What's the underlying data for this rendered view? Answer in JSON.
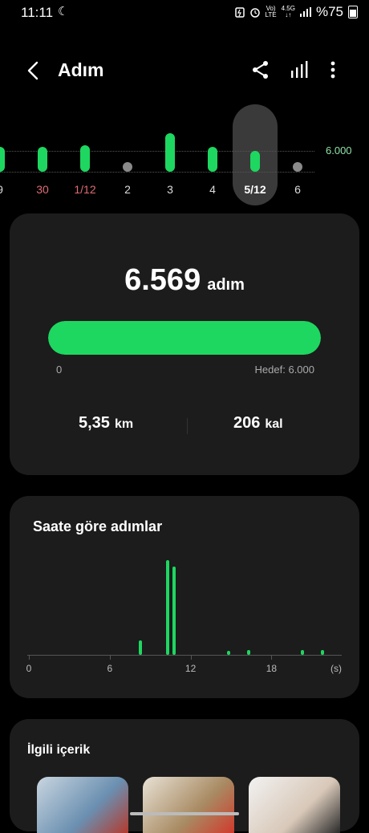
{
  "status_bar": {
    "time": "11:11",
    "moon_icon": "☾",
    "volte_top": "Vo)",
    "volte_bottom": "LTE",
    "net_top": "4.5G",
    "net_bottom": "↓↑",
    "battery_pct": "%75"
  },
  "header": {
    "title": "Adım",
    "icons": [
      "back-icon",
      "share-icon",
      "chart-icon",
      "more-icon"
    ]
  },
  "day_strip": {
    "goal_label": "6.000",
    "days": [
      {
        "label": "9",
        "value": 0.8,
        "style": "normal"
      },
      {
        "label": "30",
        "value": 0.8,
        "style": "red"
      },
      {
        "label": "1/12",
        "value": 0.9,
        "style": "red"
      },
      {
        "label": "2",
        "value": 0,
        "style": "normal"
      },
      {
        "label": "3",
        "value": 1.45,
        "style": "normal"
      },
      {
        "label": "4",
        "value": 0.8,
        "style": "normal"
      },
      {
        "label": "5/12",
        "value": 0.6,
        "style": "selected"
      },
      {
        "label": "6",
        "value": 0,
        "style": "normal"
      }
    ]
  },
  "summary": {
    "steps": "6.569",
    "steps_unit": "adım",
    "progress_fraction": 1.0,
    "progress_min": "0",
    "goal_text": "Hedef: 6.000",
    "distance_value": "5,35",
    "distance_unit": "km",
    "calories_value": "206",
    "calories_unit": "kal"
  },
  "hourly": {
    "title": "Saate göre adımlar",
    "ticks": [
      "0",
      "6",
      "12",
      "18",
      "(s)"
    ],
    "chart_data": {
      "type": "bar",
      "title": "Saate göre adımlar",
      "x_unit": "(s)",
      "xlim": [
        0,
        22
      ],
      "x": [
        8.3,
        10.3,
        10.8,
        14.8,
        16.3,
        20.3,
        21.8
      ],
      "values": [
        18,
        118,
        110,
        5,
        6,
        6,
        6
      ]
    }
  },
  "related": {
    "title": "İlgili içerik"
  },
  "colors": {
    "accent": "#1ed760",
    "card": "#1c1c1c",
    "background": "#000000"
  }
}
